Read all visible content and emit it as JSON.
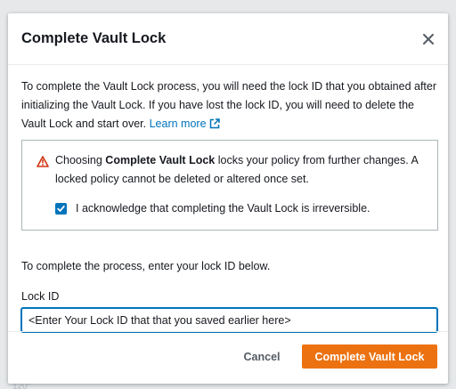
{
  "backdrop": {
    "fragment_text": "120\""
  },
  "modal": {
    "title": "Complete Vault Lock",
    "close_icon": "close-icon",
    "intro_text": "To complete the Vault Lock process, you will need the lock ID that you obtained after initializing the Vault Lock. If you have lost the lock ID, you will need to delete the Vault Lock and start over.",
    "learn_more_label": "Learn more",
    "external_link_icon": "external-link-icon",
    "warning": {
      "icon": "warning-icon",
      "text_prefix": "Choosing ",
      "text_bold": "Complete Vault Lock",
      "text_suffix": " locks your policy from further changes. A locked policy cannot be deleted or altered once set.",
      "checkbox_checked": true,
      "acknowledge_label": "I acknowledge that completing the Vault Lock is irreversible."
    },
    "process_text": "To complete the process, enter your lock ID below.",
    "lock_id": {
      "label": "Lock ID",
      "value": "<Enter Your Lock ID that that you saved earlier here>"
    },
    "footer": {
      "cancel_label": "Cancel",
      "confirm_label": "Complete Vault Lock"
    }
  },
  "colors": {
    "accent_link": "#0073bb",
    "primary_button": "#ec7211",
    "warning_icon": "#d13212",
    "checkbox": "#0073bb"
  }
}
